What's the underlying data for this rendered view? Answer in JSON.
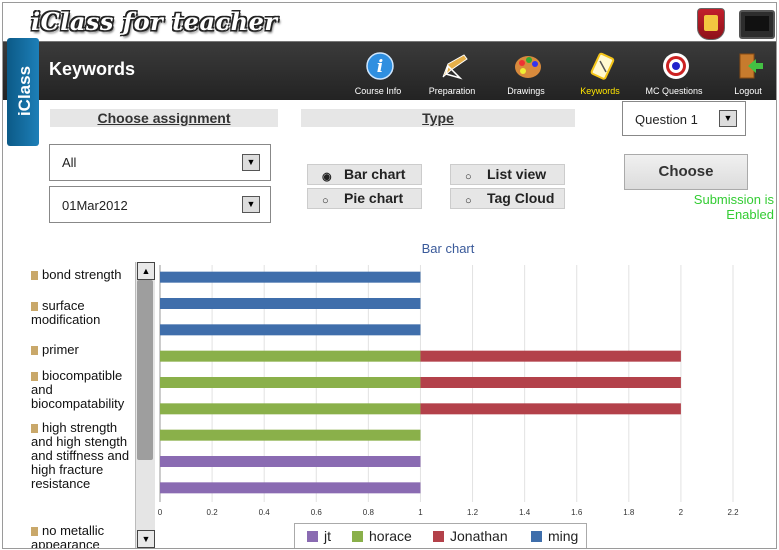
{
  "app": {
    "title": "iClass for teacher",
    "side_tab": "iClass"
  },
  "header": {
    "title": "Keywords"
  },
  "nav": [
    {
      "label": "Course Info",
      "icon": "info-icon"
    },
    {
      "label": "Preparation",
      "icon": "pencil-icon"
    },
    {
      "label": "Drawings",
      "icon": "palette-icon"
    },
    {
      "label": "Keywords",
      "icon": "notepad-icon",
      "active": true
    },
    {
      "label": "MC Questions",
      "icon": "target-icon"
    },
    {
      "label": "Logout",
      "icon": "logout-icon"
    }
  ],
  "assignment": {
    "heading": "Choose assignment",
    "filter_value": "All",
    "date_value": "01Mar2012"
  },
  "type": {
    "heading": "Type",
    "options": [
      "Bar chart",
      "Pie chart",
      "List view",
      "Tag Cloud"
    ],
    "selected": "Bar chart"
  },
  "question": {
    "value": "Question 1"
  },
  "choose_label": "Choose",
  "status": "Submission is Enabled",
  "keywords": [
    "bond strength",
    "surface modification",
    "primer",
    "biocompatible and biocompatability",
    "high strength and high stength and stiffness and high fracture resistance",
    "no metallic appearance"
  ],
  "chart_data": {
    "type": "bar",
    "orientation": "horizontal",
    "title": "Bar chart",
    "xlim": [
      0,
      2.2
    ],
    "xticks": [
      0,
      0.2,
      0.4,
      0.6,
      0.8,
      1,
      1.2,
      1.4,
      1.6,
      1.8,
      2,
      2.2
    ],
    "series": [
      {
        "name": "jt",
        "color": "#8a6bb2"
      },
      {
        "name": "horace",
        "color": "#8ab04a"
      },
      {
        "name": "Jonathan",
        "color": "#b3414a"
      },
      {
        "name": "ming",
        "color": "#3f6eab"
      }
    ],
    "bars": [
      {
        "segments": [
          {
            "series": "ming",
            "value": 1
          }
        ]
      },
      {
        "segments": [
          {
            "series": "ming",
            "value": 1
          }
        ]
      },
      {
        "segments": [
          {
            "series": "ming",
            "value": 1
          }
        ]
      },
      {
        "segments": [
          {
            "series": "horace",
            "value": 1
          },
          {
            "series": "Jonathan",
            "value": 1
          }
        ]
      },
      {
        "segments": [
          {
            "series": "horace",
            "value": 1
          },
          {
            "series": "Jonathan",
            "value": 1
          }
        ]
      },
      {
        "segments": [
          {
            "series": "horace",
            "value": 1
          },
          {
            "series": "Jonathan",
            "value": 1
          }
        ]
      },
      {
        "segments": [
          {
            "series": "horace",
            "value": 1
          }
        ]
      },
      {
        "segments": [
          {
            "series": "jt",
            "value": 1
          }
        ]
      },
      {
        "segments": [
          {
            "series": "jt",
            "value": 1
          }
        ]
      }
    ]
  }
}
